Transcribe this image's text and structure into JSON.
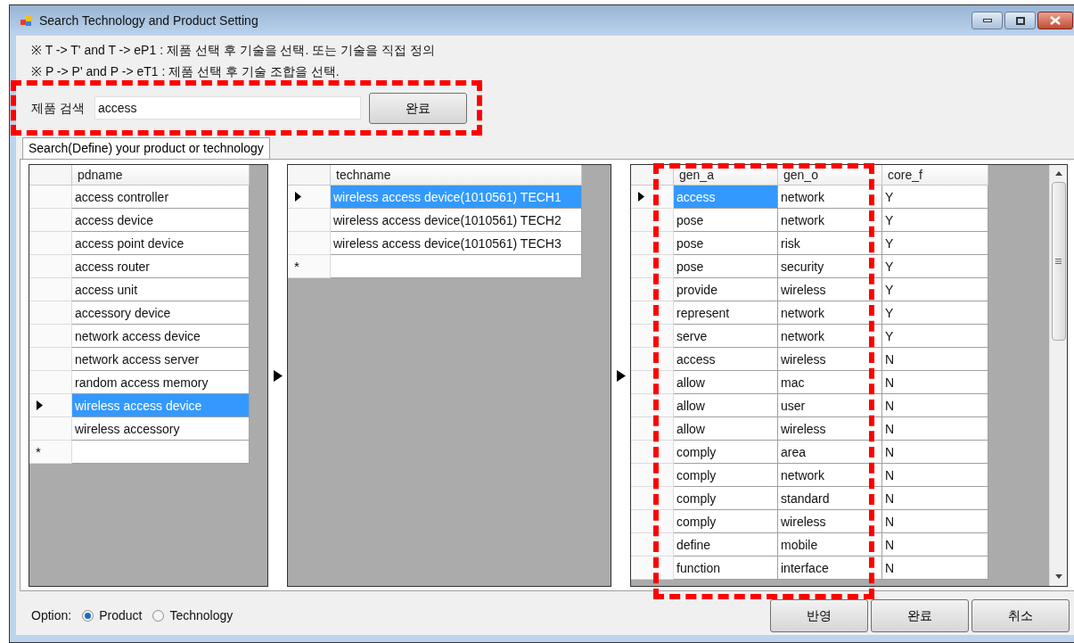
{
  "window": {
    "title": "Search Technology and Product Setting"
  },
  "notes": [
    "※ T -> T' and T -> eP1 : 제품 선택 후 기술을 선택. 또는 기술을 직접 정의",
    "※ P -> P' and P -> eT1 : 제품 선택 후 기술 조합을 선택."
  ],
  "search": {
    "label": "제품 검색",
    "value": "access",
    "button": "완료"
  },
  "tabs": [
    {
      "label": "Search(Define) your product or technology",
      "selected": true
    }
  ],
  "products": {
    "columns": [
      "pdname"
    ],
    "new_row_marker": "*",
    "rows": [
      {
        "cells": [
          "access controller"
        ],
        "selected": false
      },
      {
        "cells": [
          "access device"
        ],
        "selected": false
      },
      {
        "cells": [
          "access point device"
        ],
        "selected": false
      },
      {
        "cells": [
          "access router"
        ],
        "selected": false
      },
      {
        "cells": [
          "access unit"
        ],
        "selected": false
      },
      {
        "cells": [
          "accessory device"
        ],
        "selected": false
      },
      {
        "cells": [
          "network access device"
        ],
        "selected": false
      },
      {
        "cells": [
          "network access server"
        ],
        "selected": false
      },
      {
        "cells": [
          "random access memory"
        ],
        "selected": false
      },
      {
        "cells": [
          "wireless access device"
        ],
        "selected": true
      },
      {
        "cells": [
          "wireless accessory"
        ],
        "selected": false
      }
    ]
  },
  "technologies": {
    "columns": [
      "techname"
    ],
    "new_row_marker": "*",
    "rows": [
      {
        "cells": [
          "wireless access device(1010561) TECH1"
        ],
        "selected": true
      },
      {
        "cells": [
          "wireless access device(1010561) TECH2"
        ],
        "selected": false
      },
      {
        "cells": [
          "wireless access device(1010561) TECH3"
        ],
        "selected": false
      }
    ]
  },
  "combinations": {
    "columns": [
      "gen_a",
      "gen_o",
      "core_f"
    ],
    "rows": [
      {
        "cells": [
          "access",
          "network",
          "Y"
        ],
        "selected": true
      },
      {
        "cells": [
          "pose",
          "network",
          "Y"
        ],
        "selected": false
      },
      {
        "cells": [
          "pose",
          "risk",
          "Y"
        ],
        "selected": false
      },
      {
        "cells": [
          "pose",
          "security",
          "Y"
        ],
        "selected": false
      },
      {
        "cells": [
          "provide",
          "wireless",
          "Y"
        ],
        "selected": false
      },
      {
        "cells": [
          "represent",
          "network",
          "Y"
        ],
        "selected": false
      },
      {
        "cells": [
          "serve",
          "network",
          "Y"
        ],
        "selected": false
      },
      {
        "cells": [
          "access",
          "wireless",
          "N"
        ],
        "selected": false
      },
      {
        "cells": [
          "allow",
          "mac",
          "N"
        ],
        "selected": false
      },
      {
        "cells": [
          "allow",
          "user",
          "N"
        ],
        "selected": false
      },
      {
        "cells": [
          "allow",
          "wireless",
          "N"
        ],
        "selected": false
      },
      {
        "cells": [
          "comply",
          "area",
          "N"
        ],
        "selected": false
      },
      {
        "cells": [
          "comply",
          "network",
          "N"
        ],
        "selected": false
      },
      {
        "cells": [
          "comply",
          "standard",
          "N"
        ],
        "selected": false
      },
      {
        "cells": [
          "comply",
          "wireless",
          "N"
        ],
        "selected": false
      },
      {
        "cells": [
          "define",
          "mobile",
          "N"
        ],
        "selected": false
      },
      {
        "cells": [
          "function",
          "interface",
          "N"
        ],
        "selected": false
      }
    ]
  },
  "option": {
    "label": "Option:",
    "choices": [
      {
        "label": "Product",
        "selected": true
      },
      {
        "label": "Technology",
        "selected": false
      }
    ]
  },
  "buttons": [
    "반영",
    "완료",
    "취소"
  ]
}
